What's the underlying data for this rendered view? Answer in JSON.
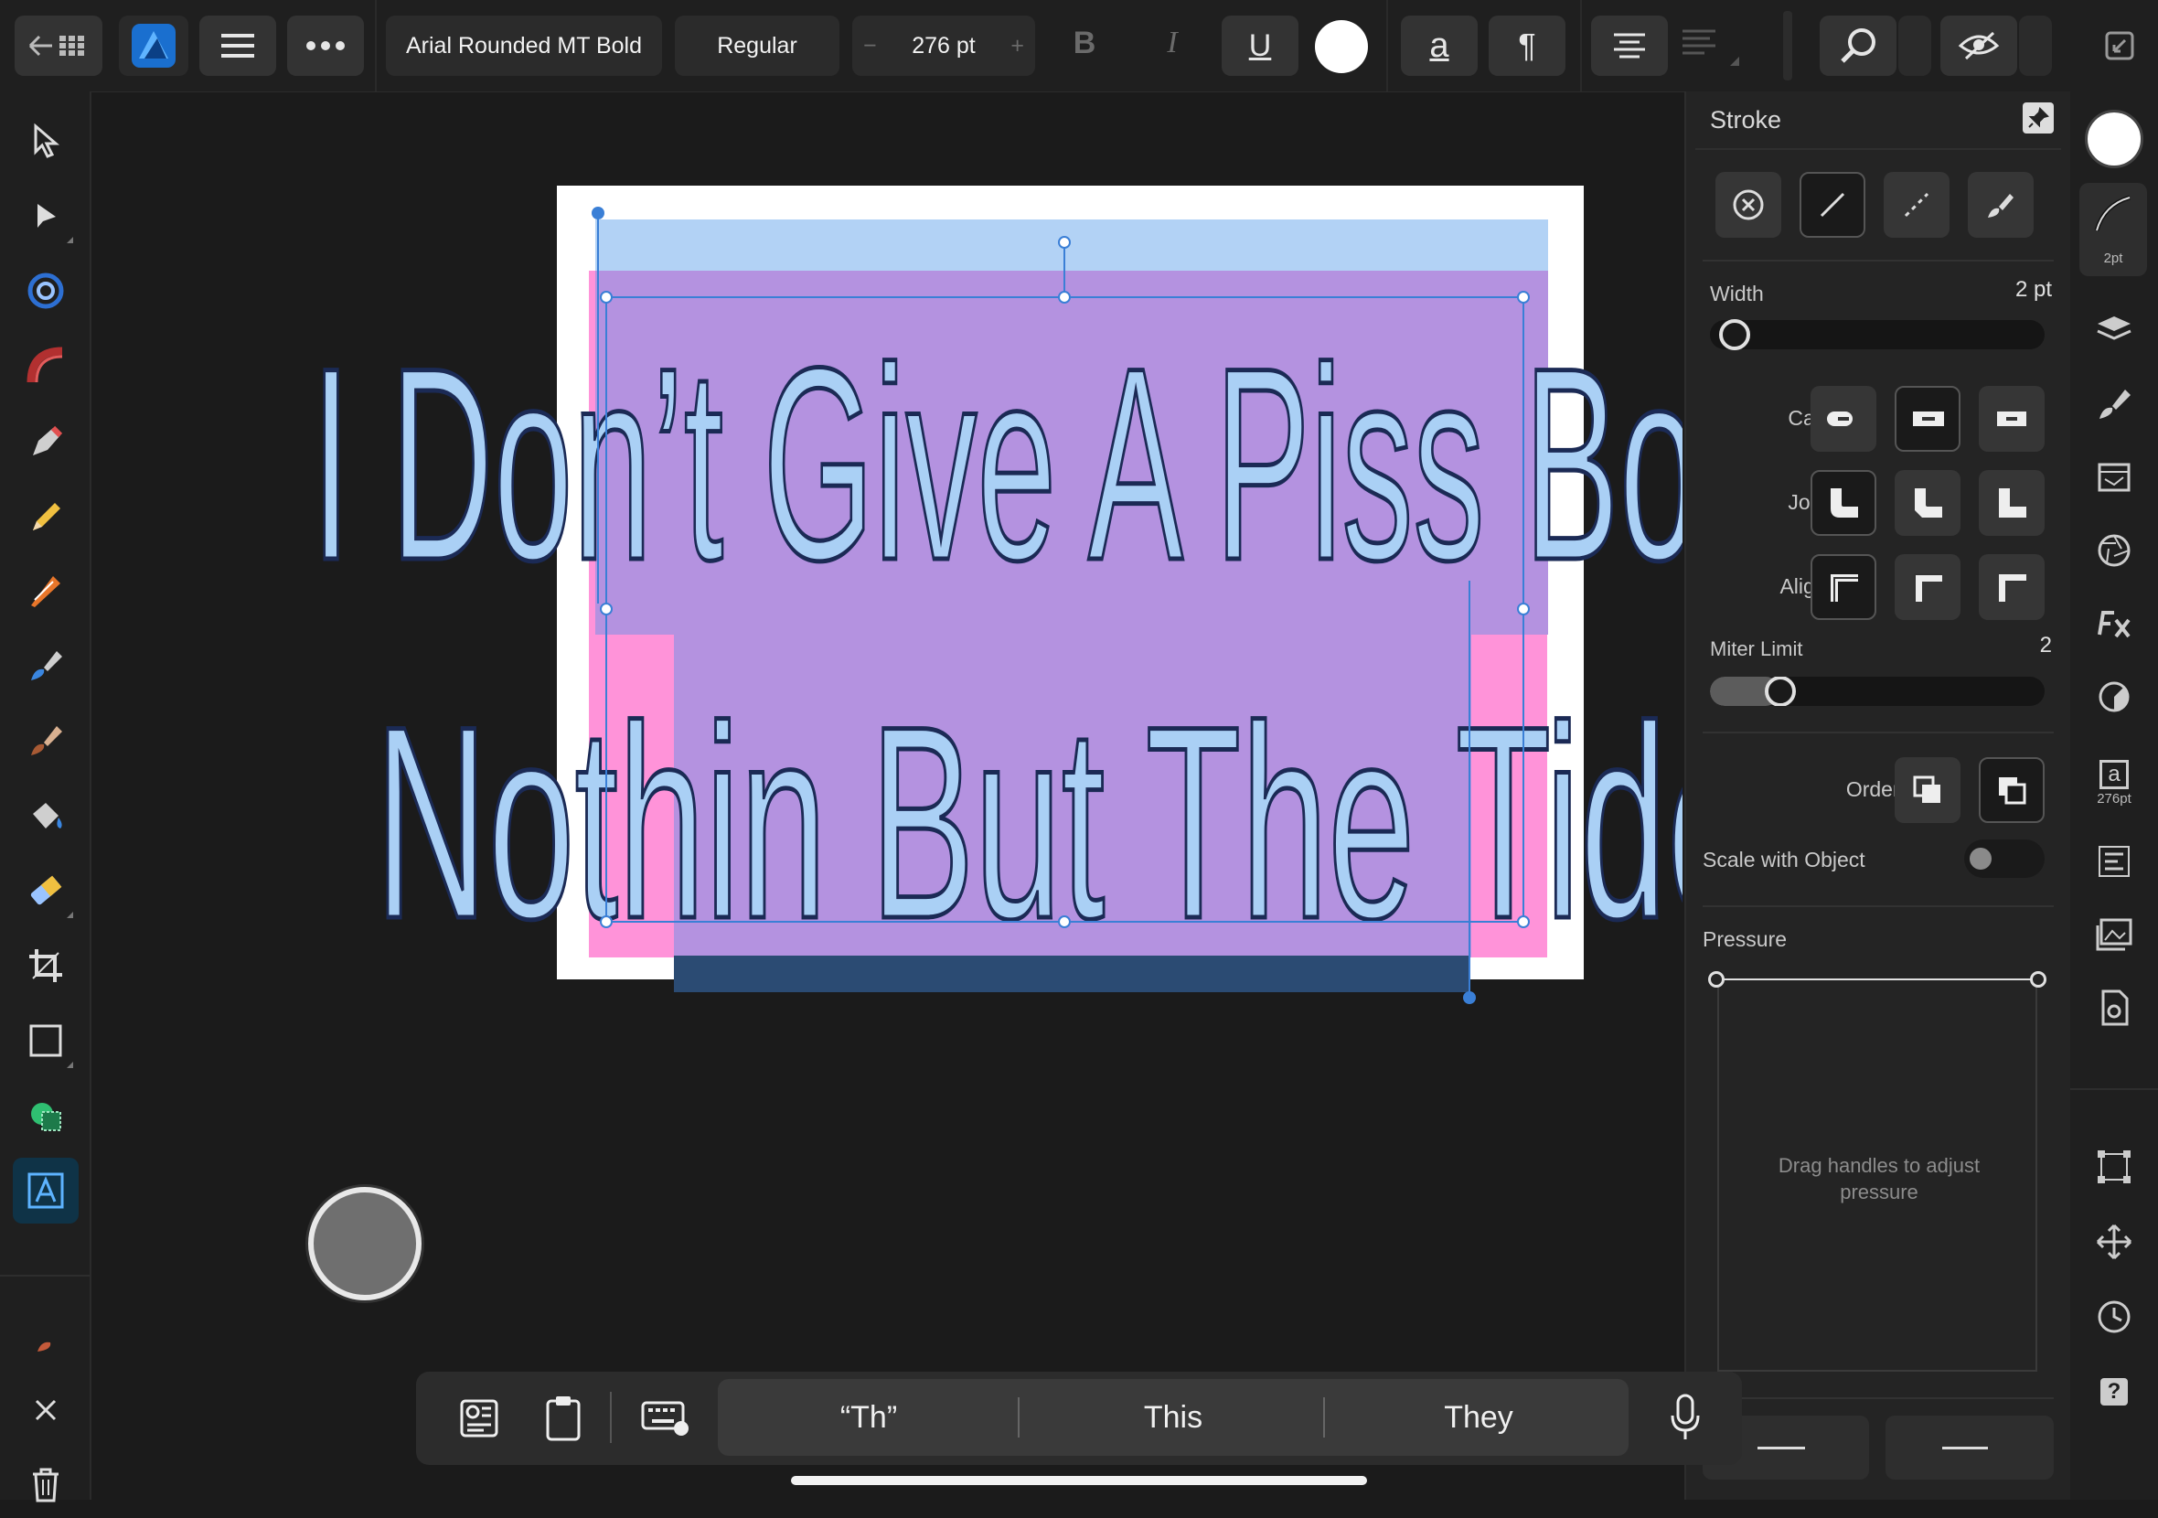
{
  "toolbar": {
    "font_family": "Arial Rounded MT Bold",
    "font_style": "Regular",
    "font_size": "276 pt",
    "decrease_symbol": "−",
    "increase_symbol": "+",
    "bold_label": "B",
    "italic_label": "I",
    "underline_label": "U",
    "char_label": "a",
    "paragraph_label": "¶",
    "text_color": "#ffffff"
  },
  "document": {
    "line1": "I Don’t Give A Piss Bout",
    "line2": "Nothin But The Tide",
    "text_fill": "#aad0f5",
    "text_stroke": "#1b2a55",
    "colors": {
      "page": "#ffffff",
      "frame_top": "#b2d2f5",
      "pink": "#ff93d9",
      "purple": "#b492e0",
      "selection": "#3a7fd6",
      "lower_bar": "#2b4b73"
    }
  },
  "stroke_panel": {
    "title": "Stroke",
    "width_label": "Width",
    "width_value": "2 pt",
    "width_fraction": 0.03,
    "cap_label": "Cap:",
    "join_label": "Join:",
    "align_label": "Align:",
    "miter_label": "Miter Limit",
    "miter_value": "2",
    "miter_fraction": 0.18,
    "order_label": "Order:",
    "scale_label": "Scale with Object",
    "scale_on": false,
    "pressure_label": "Pressure",
    "pressure_hint": "Drag handles to adjust pressure"
  },
  "studio": {
    "stroke_caption": "2pt",
    "text_caption": "276pt",
    "text_glyph": "a",
    "help_glyph": "?"
  },
  "keyboard_bar": {
    "predictions": [
      "“Th”",
      "This",
      "They"
    ]
  }
}
